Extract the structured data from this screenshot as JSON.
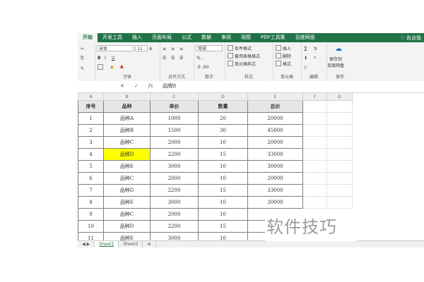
{
  "ribbon_tabs": [
    "开始",
    "开发工具",
    "插入",
    "页面布局",
    "公式",
    "数据",
    "审阅",
    "视图",
    "PDF工具集",
    "百度网盘"
  ],
  "help": "♡ 告诉我",
  "ribbon": {
    "font_name": "宋体",
    "font_size": "11",
    "bold": "B",
    "italic": "I",
    "underline": "U",
    "number_format": "常规",
    "cond_format": "条件格式",
    "table_format": "套用表格格式",
    "cell_style": "单元格样式",
    "insert": "插入",
    "delete": "删除",
    "format": "格式",
    "save_label1": "保存到",
    "save_label2": "百度网盘",
    "groups": [
      "字体",
      "对齐方式",
      "数字",
      "样式",
      "单元格",
      "编辑",
      "保存"
    ]
  },
  "formula_bar": {
    "fx": "fx",
    "cancel": "✕",
    "confirm": "✓",
    "content": "品牌D"
  },
  "columns": [
    "A",
    "B",
    "C",
    "D",
    "E",
    "F",
    "G"
  ],
  "headers": [
    "序号",
    "品种",
    "单价",
    "数量",
    "总价"
  ],
  "rows": [
    [
      "1",
      "品种A",
      "1000",
      "20",
      "20000"
    ],
    [
      "2",
      "品种B",
      "1500",
      "30",
      "45000"
    ],
    [
      "3",
      "品种C",
      "2000",
      "10",
      "20000"
    ],
    [
      "4",
      "品牌D",
      "2200",
      "15",
      "33000"
    ],
    [
      "5",
      "品种E",
      "3000",
      "10",
      "30000"
    ],
    [
      "6",
      "品种C",
      "2000",
      "10",
      "20000"
    ],
    [
      "7",
      "品种D",
      "2200",
      "15",
      "33000"
    ],
    [
      "8",
      "品种E",
      "3000",
      "10",
      "30000"
    ],
    [
      "9",
      "品种C",
      "2000",
      "10",
      ""
    ],
    [
      "10",
      "品种D",
      "2200",
      "15",
      ""
    ],
    [
      "11",
      "品种E",
      "3000",
      "10",
      ""
    ]
  ],
  "sheet_tabs": [
    "Sheet1",
    "Sheet2"
  ],
  "watermark": "软件技巧",
  "colors": {
    "ribbon": "#217346",
    "selected_fill": "#ffff00",
    "header_fill": "#e7e6e6"
  }
}
